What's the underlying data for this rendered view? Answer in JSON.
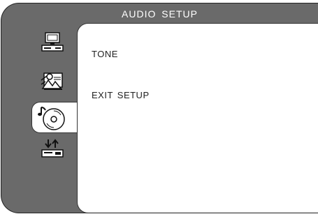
{
  "title": "AUDIO SETUP",
  "sidebar": {
    "icons": [
      {
        "name": "general-setup-icon",
        "state": "inactive"
      },
      {
        "name": "video-setup-icon",
        "state": "inactive"
      },
      {
        "name": "audio-setup-icon",
        "state": "selected"
      },
      {
        "name": "preference-setup-icon",
        "state": "inactive"
      }
    ]
  },
  "menu": {
    "items": [
      {
        "label": "TONE"
      },
      {
        "label": "EXIT  SETUP"
      }
    ]
  },
  "colors": {
    "frame": "#6a6a6a",
    "panel": "#ffffff",
    "title_text": "#ffffff",
    "menu_text": "#222222"
  }
}
